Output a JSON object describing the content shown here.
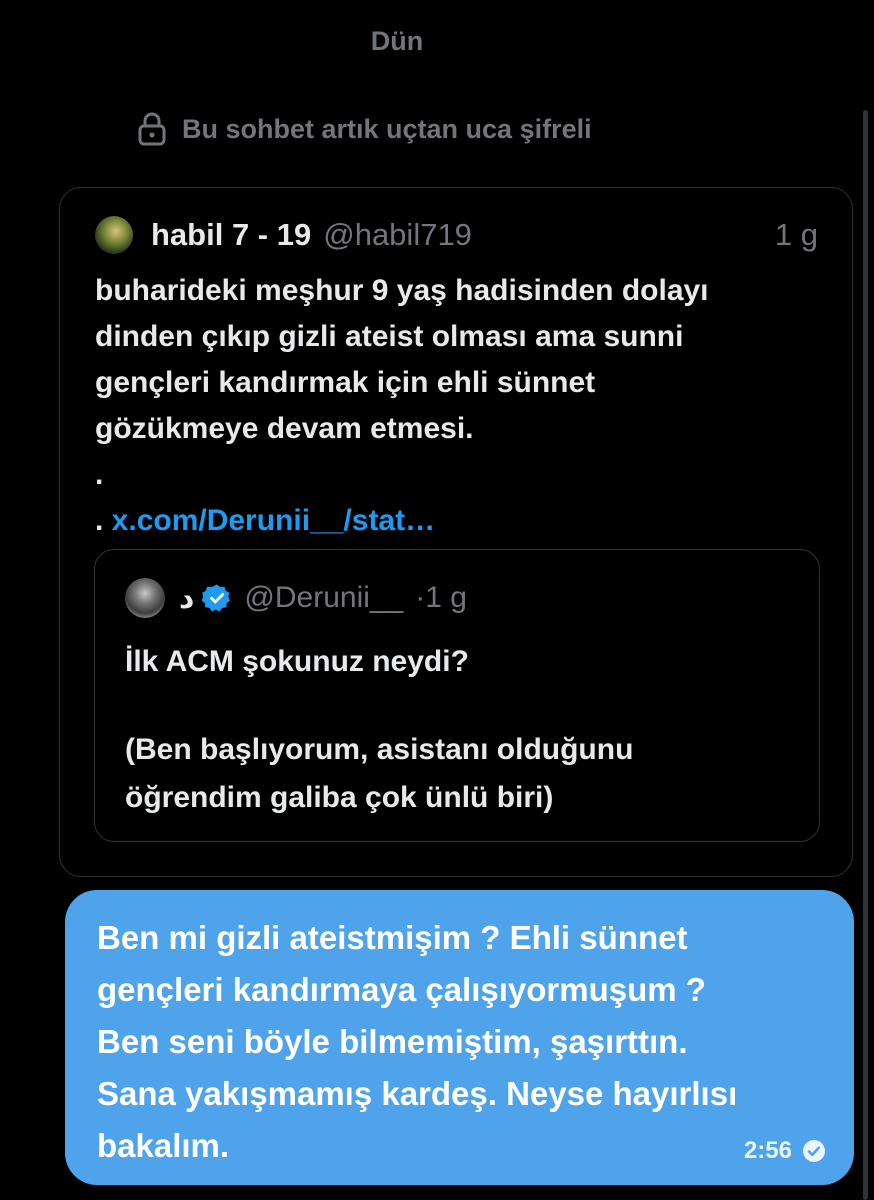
{
  "date_divider": "Dün",
  "encryption_notice": "Bu sohbet artık uçtan uca şifreli",
  "shared_post": {
    "author_name": "habil 7 - 19",
    "author_handle": "@habil719",
    "time": "1 g",
    "lines": [
      "buharideki meşhur 9 yaş hadisinden dolayı",
      "dinden çıkıp gizli ateist olması ama sunni",
      "gençleri kandırmak için ehli sünnet",
      "gözükmeye devam etmesi.",
      "."
    ],
    "link_prefix": ". ",
    "link_text": "x.com/Derunii__/stat…",
    "quoted": {
      "author_name": "د",
      "author_handle": "@Derunii__",
      "time": "·1 g",
      "line1": "İlk ACM şokunuz neydi?",
      "line2": "(Ben başlıyorum, asistanı olduğunu",
      "line3": "öğrendim galiba çok ünlü biri)"
    }
  },
  "my_message": {
    "lines": [
      "Ben mi gizli ateistmişim ? Ehli sünnet",
      "gençleri kandırmaya çalışıyormuşum ?",
      "Ben seni böyle bilmemiştim, şaşırttın.",
      "Sana yakışmamış kardeş. Neyse hayırlısı",
      "bakalım."
    ],
    "time": "2:56",
    "status_icon": "read-check-icon"
  },
  "colors": {
    "background": "#000000",
    "bubble": "#4fa3ea",
    "link": "#1d9bf0",
    "verified": "#1d9bf0",
    "muted": "#71767b"
  }
}
